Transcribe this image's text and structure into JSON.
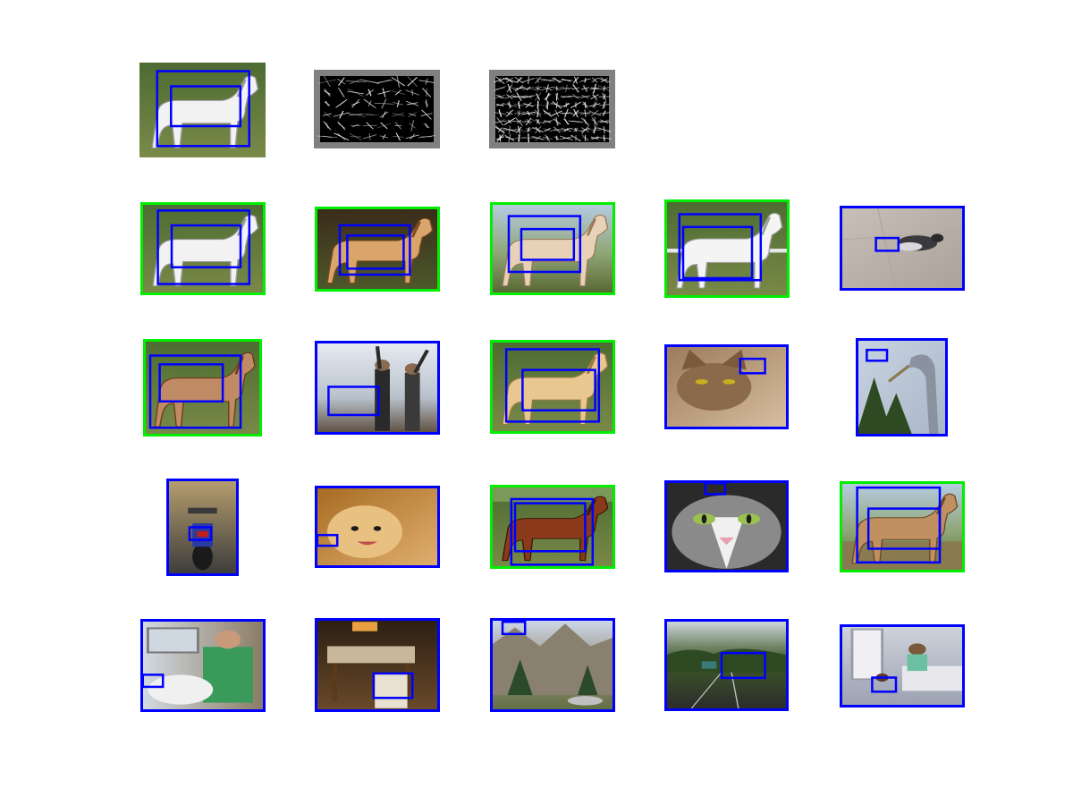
{
  "colors": {
    "background": "#ffffff",
    "detection_box": "#0000ff",
    "correct_frame": "#00ee00",
    "wrong_frame": "#0000ff",
    "feature_bg": "#808080"
  },
  "query": {
    "scene": "white-horse-field",
    "icon": "white-horse-image",
    "features": [
      "hog-root-filter-icon",
      "hog-part-filters-icon"
    ]
  },
  "results": [
    {
      "scene": "white-horse-field",
      "correct": true
    },
    {
      "scene": "palomino-horse-dark",
      "correct": true
    },
    {
      "scene": "palomino-horse-sky",
      "correct": true
    },
    {
      "scene": "white-horse-fence",
      "correct": true
    },
    {
      "scene": "pigeon-pavement",
      "correct": false
    },
    {
      "scene": "chestnut-horse-trees",
      "correct": true
    },
    {
      "scene": "people-mountains",
      "correct": false
    },
    {
      "scene": "palomino-horse-grass",
      "correct": true
    },
    {
      "scene": "abyssinian-cat",
      "correct": false
    },
    {
      "scene": "heron-pine",
      "correct": false
    },
    {
      "scene": "motorcycle-street",
      "correct": false
    },
    {
      "scene": "pomeranian-dog",
      "correct": false
    },
    {
      "scene": "bay-horse-field",
      "correct": true
    },
    {
      "scene": "grey-cat-closeup",
      "correct": false
    },
    {
      "scene": "dun-horse-sky",
      "correct": true
    },
    {
      "scene": "man-dog-car",
      "correct": false
    },
    {
      "scene": "dining-room",
      "correct": false
    },
    {
      "scene": "castle-building",
      "correct": false
    },
    {
      "scene": "railway-tracks",
      "correct": false
    },
    {
      "scene": "living-room-person",
      "correct": false
    }
  ]
}
